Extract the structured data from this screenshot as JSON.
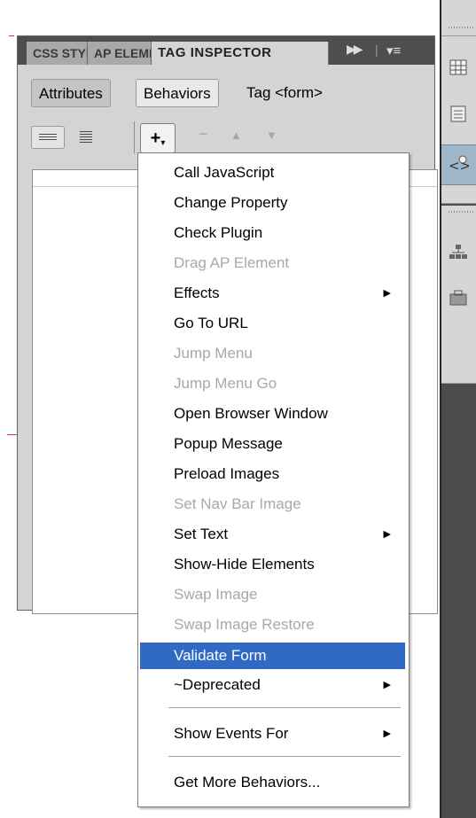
{
  "panel": {
    "tabs": [
      {
        "label": "CSS STYLES"
      },
      {
        "label": "AP ELEMENTS"
      },
      {
        "label": "TAG INSPECTOR"
      }
    ],
    "controls": {
      "expand_icon": "double-arrow-right-icon",
      "options_icon": "panel-menu-icon"
    },
    "subtabs": {
      "attributes": "Attributes",
      "behaviors": "Behaviors",
      "tag": "Tag <form>"
    },
    "toolbar": {
      "show_set_events_icon": "show-set-events-icon",
      "show_all_events_icon": "show-all-events-icon",
      "add_behavior_label": "+",
      "remove_behavior_label": "−",
      "move_up_label": "▲",
      "move_down_label": "▼"
    }
  },
  "menu": {
    "items": [
      {
        "label": "Call JavaScript",
        "enabled": true
      },
      {
        "label": "Change Property",
        "enabled": true
      },
      {
        "label": "Check Plugin",
        "enabled": true
      },
      {
        "label": "Drag AP Element",
        "enabled": false
      },
      {
        "label": "Effects",
        "enabled": true,
        "submenu": true
      },
      {
        "label": "Go To URL",
        "enabled": true
      },
      {
        "label": "Jump Menu",
        "enabled": false
      },
      {
        "label": "Jump Menu Go",
        "enabled": false
      },
      {
        "label": "Open Browser Window",
        "enabled": true
      },
      {
        "label": "Popup Message",
        "enabled": true
      },
      {
        "label": "Preload Images",
        "enabled": true
      },
      {
        "label": "Set Nav Bar Image",
        "enabled": false
      },
      {
        "label": "Set Text",
        "enabled": true,
        "submenu": true
      },
      {
        "label": "Show-Hide Elements",
        "enabled": true
      },
      {
        "label": "Swap Image",
        "enabled": false
      },
      {
        "label": "Swap Image Restore",
        "enabled": false
      },
      {
        "label": "Validate Form",
        "enabled": true,
        "highlighted": true
      },
      {
        "label": "~Deprecated",
        "enabled": true,
        "submenu": true
      },
      {
        "label": "Show Events For",
        "enabled": true,
        "submenu": true
      },
      {
        "label": "Get More Behaviors...",
        "enabled": true
      }
    ],
    "submenu_arrow": "▶"
  },
  "side_panel": {
    "icons": [
      "table-icon",
      "document-icon",
      "tag-code-icon",
      "sitemap-icon",
      "toolbox-icon"
    ]
  },
  "colors": {
    "highlight": "#316ac5",
    "disabled_text": "#a8a8a8",
    "panel_bg": "#d4d4d4"
  }
}
